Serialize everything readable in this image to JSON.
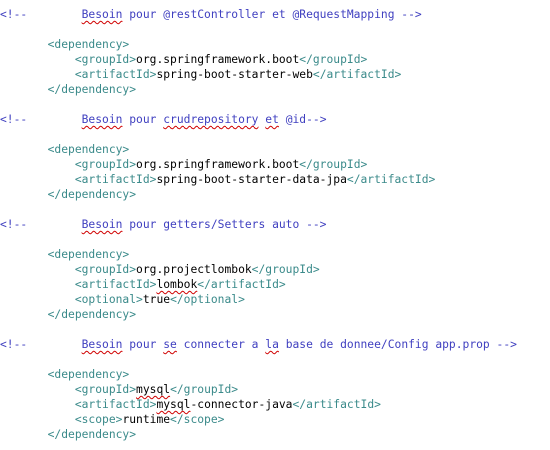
{
  "editor": {
    "colors": {
      "comment": "#4040c0",
      "tag": "#3a8a8a",
      "text": "#000000",
      "spellcheck": "#d00000"
    },
    "lines": [
      [
        {
          "t": "<!--        ",
          "c": "comment"
        },
        {
          "t": "Besoin",
          "c": "comment",
          "s": true
        },
        {
          "t": " pour @restController et @RequestMapping -->",
          "c": "comment"
        }
      ],
      [],
      [
        {
          "t": "       ",
          "c": "text"
        },
        {
          "t": "<dependency>",
          "c": "tag"
        }
      ],
      [
        {
          "t": "           ",
          "c": "text"
        },
        {
          "t": "<groupId>",
          "c": "tag"
        },
        {
          "t": "org.springframework.boot",
          "c": "text"
        },
        {
          "t": "</groupId>",
          "c": "tag"
        }
      ],
      [
        {
          "t": "           ",
          "c": "text"
        },
        {
          "t": "<artifactId>",
          "c": "tag"
        },
        {
          "t": "spring-boot-starter-web",
          "c": "text"
        },
        {
          "t": "</artifactId>",
          "c": "tag"
        }
      ],
      [
        {
          "t": "       ",
          "c": "text"
        },
        {
          "t": "</dependency>",
          "c": "tag"
        }
      ],
      [],
      [
        {
          "t": "<!--        ",
          "c": "comment"
        },
        {
          "t": "Besoin",
          "c": "comment",
          "s": true
        },
        {
          "t": " pour ",
          "c": "comment"
        },
        {
          "t": "crudrepository",
          "c": "comment",
          "s": true
        },
        {
          "t": " ",
          "c": "comment"
        },
        {
          "t": "et",
          "c": "comment",
          "s": true
        },
        {
          "t": " @id-->",
          "c": "comment"
        }
      ],
      [],
      [
        {
          "t": "       ",
          "c": "text"
        },
        {
          "t": "<dependency>",
          "c": "tag"
        }
      ],
      [
        {
          "t": "           ",
          "c": "text"
        },
        {
          "t": "<groupId>",
          "c": "tag"
        },
        {
          "t": "org.springframework.boot",
          "c": "text"
        },
        {
          "t": "</groupId>",
          "c": "tag"
        }
      ],
      [
        {
          "t": "           ",
          "c": "text"
        },
        {
          "t": "<artifactId>",
          "c": "tag"
        },
        {
          "t": "spring-boot-starter-data-jpa",
          "c": "text"
        },
        {
          "t": "</artifactId>",
          "c": "tag"
        }
      ],
      [
        {
          "t": "       ",
          "c": "text"
        },
        {
          "t": "</dependency>",
          "c": "tag"
        }
      ],
      [],
      [
        {
          "t": "<!--        ",
          "c": "comment"
        },
        {
          "t": "Besoin",
          "c": "comment",
          "s": true
        },
        {
          "t": " pour getters/Setters auto -->",
          "c": "comment"
        }
      ],
      [],
      [
        {
          "t": "       ",
          "c": "text"
        },
        {
          "t": "<dependency>",
          "c": "tag"
        }
      ],
      [
        {
          "t": "           ",
          "c": "text"
        },
        {
          "t": "<groupId>",
          "c": "tag"
        },
        {
          "t": "org.projectlombok",
          "c": "text"
        },
        {
          "t": "</groupId>",
          "c": "tag"
        }
      ],
      [
        {
          "t": "           ",
          "c": "text"
        },
        {
          "t": "<artifactId>",
          "c": "tag"
        },
        {
          "t": "lombok",
          "c": "text",
          "s": true
        },
        {
          "t": "</artifactId>",
          "c": "tag"
        }
      ],
      [
        {
          "t": "           ",
          "c": "text"
        },
        {
          "t": "<optional>",
          "c": "tag"
        },
        {
          "t": "true",
          "c": "text"
        },
        {
          "t": "</optional>",
          "c": "tag"
        }
      ],
      [
        {
          "t": "       ",
          "c": "text"
        },
        {
          "t": "</dependency>",
          "c": "tag"
        }
      ],
      [],
      [
        {
          "t": "<!--        ",
          "c": "comment"
        },
        {
          "t": "Besoin",
          "c": "comment",
          "s": true
        },
        {
          "t": " pour ",
          "c": "comment"
        },
        {
          "t": "se",
          "c": "comment",
          "s": true
        },
        {
          "t": " connecter a ",
          "c": "comment"
        },
        {
          "t": "la",
          "c": "comment",
          "s": true
        },
        {
          "t": " base de donnee/Config app.prop -->",
          "c": "comment"
        }
      ],
      [],
      [
        {
          "t": "       ",
          "c": "text"
        },
        {
          "t": "<dependency>",
          "c": "tag"
        }
      ],
      [
        {
          "t": "           ",
          "c": "text"
        },
        {
          "t": "<groupId>",
          "c": "tag"
        },
        {
          "t": "mysql",
          "c": "text",
          "s": true
        },
        {
          "t": "</groupId>",
          "c": "tag"
        }
      ],
      [
        {
          "t": "           ",
          "c": "text"
        },
        {
          "t": "<artifactId>",
          "c": "tag"
        },
        {
          "t": "mysql",
          "c": "text",
          "s": true
        },
        {
          "t": "-connector-java",
          "c": "text"
        },
        {
          "t": "</artifactId>",
          "c": "tag"
        }
      ],
      [
        {
          "t": "           ",
          "c": "text"
        },
        {
          "t": "<scope>",
          "c": "tag"
        },
        {
          "t": "runtime",
          "c": "text"
        },
        {
          "t": "</scope>",
          "c": "tag"
        }
      ],
      [
        {
          "t": "       ",
          "c": "text"
        },
        {
          "t": "</dependency>",
          "c": "tag"
        }
      ]
    ]
  }
}
